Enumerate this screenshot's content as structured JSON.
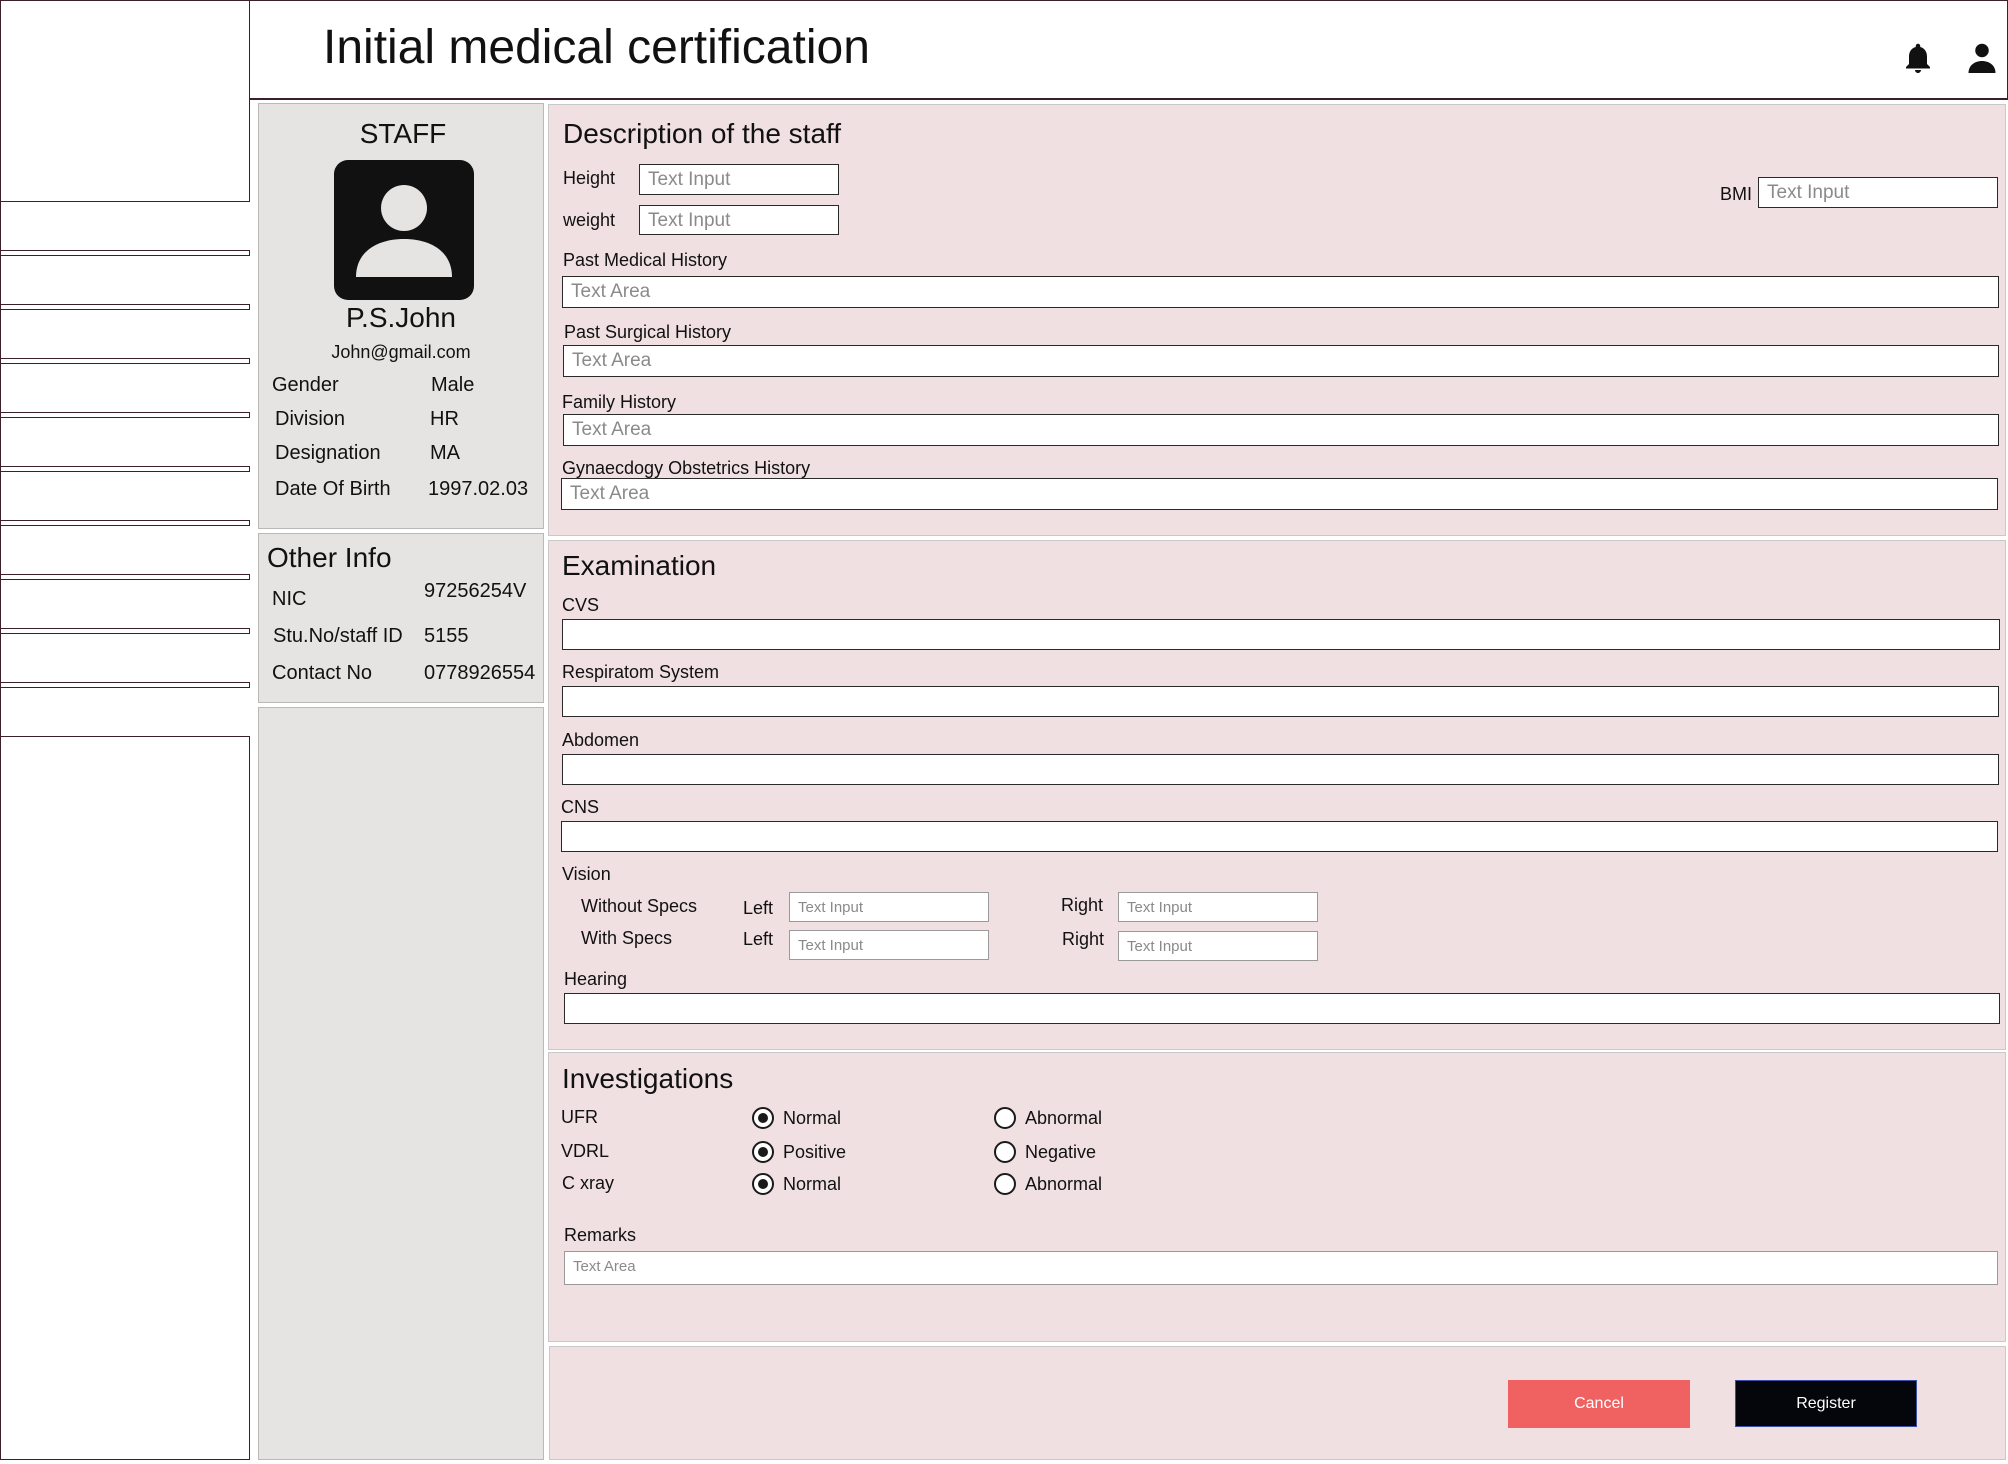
{
  "header": {
    "title": "Initial medical certification",
    "icons": [
      "bell-icon",
      "user-icon"
    ]
  },
  "sidebar": {
    "items": [
      "",
      "",
      "",
      "",
      "",
      "",
      "",
      "",
      "",
      ""
    ]
  },
  "staff_card": {
    "heading": "STAFF",
    "name": "P.S.John",
    "email": "John@gmail.com",
    "fields": [
      {
        "label": "Gender",
        "value": "Male"
      },
      {
        "label": "Division",
        "value": "HR"
      },
      {
        "label": "Designation",
        "value": "MA"
      },
      {
        "label": "Date Of Birth",
        "value": "1997.02.03"
      }
    ]
  },
  "other_info": {
    "heading": "Other Info",
    "fields": [
      {
        "label": "NIC",
        "value": "97256254V"
      },
      {
        "label": "Stu.No/staff ID",
        "value": "5155"
      },
      {
        "label": "Contact No",
        "value": "0778926554"
      }
    ]
  },
  "description": {
    "heading": "Description of the staff",
    "height_label": "Height",
    "height_placeholder": "Text Input",
    "weight_label": "weight",
    "weight_placeholder": "Text Input",
    "bmi_label": "BMI",
    "bmi_placeholder": "Text Input",
    "past_medical_label": "Past Medical History",
    "past_surgical_label": "Past Surgical History",
    "family_label": "Family History",
    "gyn_label": "Gynaecdogy Obstetrics History",
    "textarea_placeholder": "Text Area"
  },
  "examination": {
    "heading": "Examination",
    "cvs_label": "CVS",
    "resp_label": "Respiratom System",
    "abdomen_label": "Abdomen",
    "cns_label": "CNS",
    "vision_label": "Vision",
    "without_specs": "Without Specs",
    "with_specs": "With Specs",
    "left_label": "Left",
    "right_label": "Right",
    "input_placeholder": "Text Input",
    "hearing_label": "Hearing"
  },
  "investigations": {
    "heading": "Investigations",
    "rows": [
      {
        "label": "UFR",
        "option1": "Normal",
        "option2": "Abnormal",
        "selected": 1
      },
      {
        "label": "VDRL",
        "option1": "Positive",
        "option2": "Negative",
        "selected": 1
      },
      {
        "label": "C xray",
        "option1": "Normal",
        "option2": "Abnormal",
        "selected": 1
      }
    ],
    "remarks_label": "Remarks",
    "remarks_placeholder": "Text Area"
  },
  "actions": {
    "cancel_label": "Cancel",
    "register_label": "Register",
    "cancel_color": "#f06262",
    "register_color": "#05060c"
  }
}
